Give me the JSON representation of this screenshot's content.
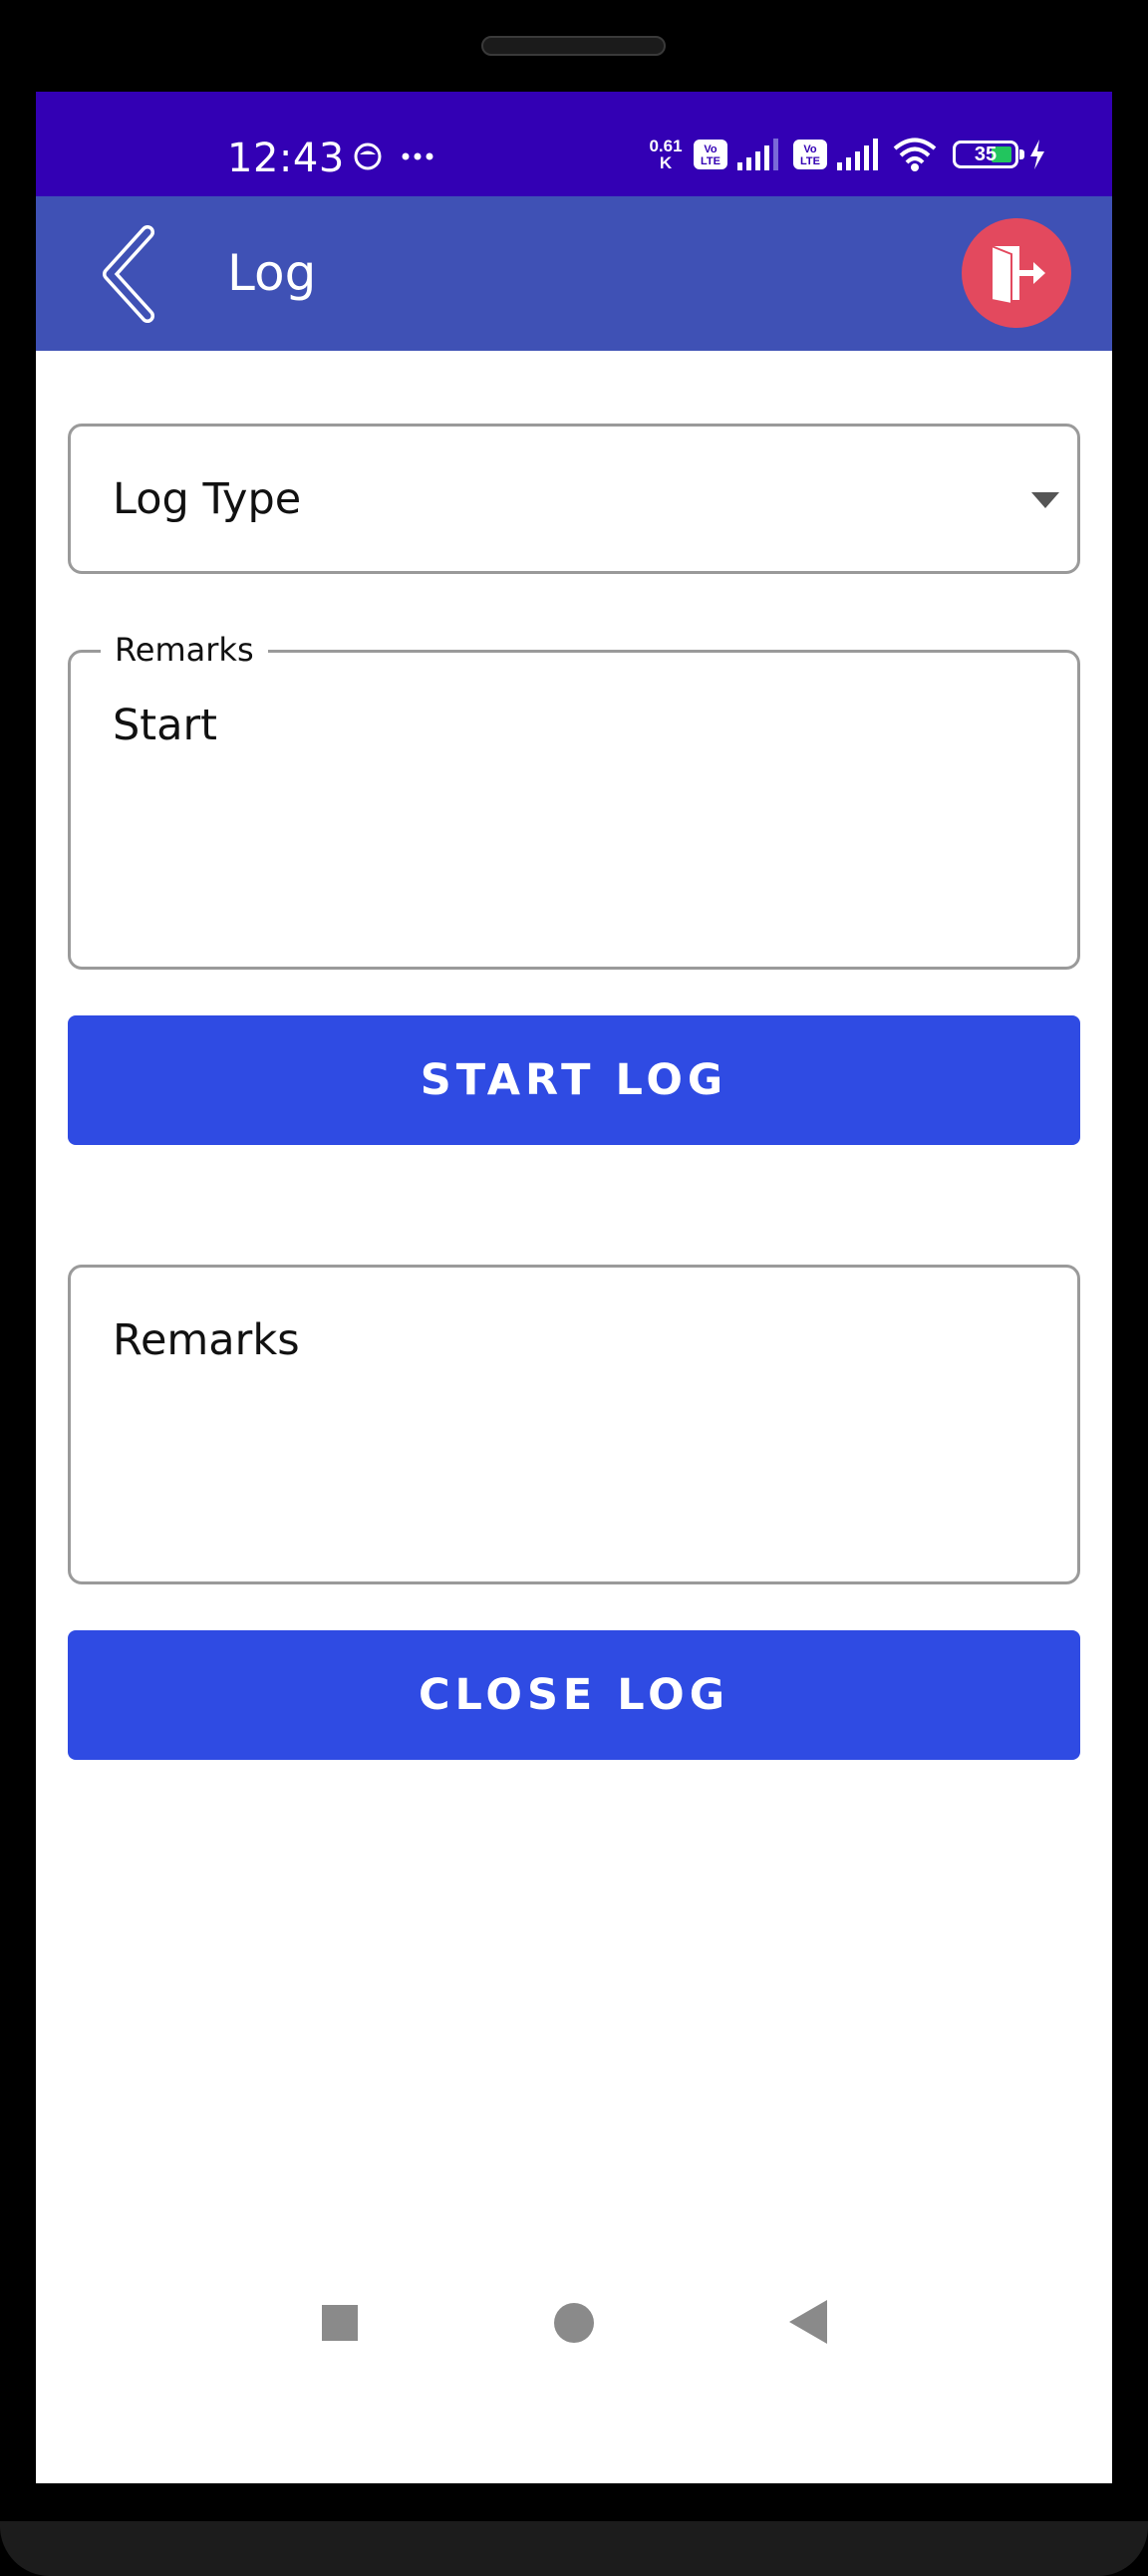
{
  "status_bar": {
    "time": "12:43",
    "net_speed": "0.61\nK",
    "volte_1": "Vo\nLTE",
    "volte_2": "Vo\nLTE",
    "battery_level": "35",
    "icons": [
      "notification-face-icon",
      "more-dots-icon",
      "signal-icon",
      "wifi-icon",
      "battery-icon",
      "charging-icon"
    ]
  },
  "app_bar": {
    "title": "Log",
    "back_icon": "chevron-left-icon",
    "logout_icon": "exit-door-icon",
    "logout_color": "#e3495e",
    "background": "#3f51b5"
  },
  "form": {
    "log_type_label": "Log Type",
    "remarks_start_label": "Remarks",
    "remarks_start_value": "Start",
    "start_button_label": "START LOG",
    "remarks_close_placeholder": "Remarks",
    "close_button_label": "CLOSE LOG",
    "button_color": "#2f4be3"
  },
  "nav_bar": {
    "icons": [
      "recents-square-icon",
      "home-circle-icon",
      "back-triangle-icon"
    ]
  }
}
